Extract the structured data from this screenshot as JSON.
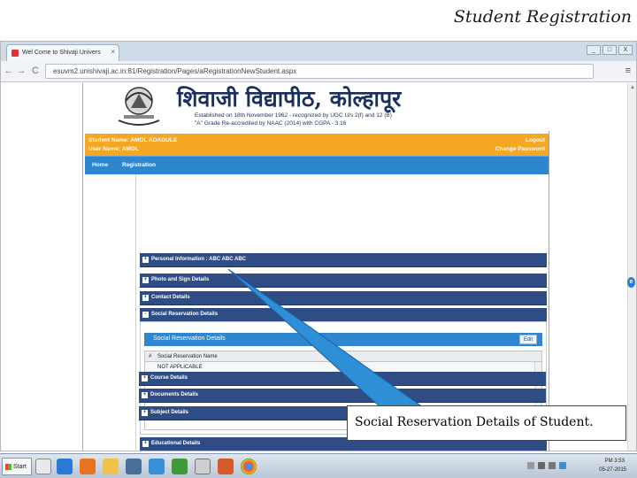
{
  "slide": {
    "title": "Student Registration",
    "callout_text": "Social Reservation Details of Student."
  },
  "browser": {
    "tab_title": "Wel Come to Shivaji Univers",
    "tab_close": "×",
    "url": "esuvm2.unishivaji.ac.in:81/Registration/Pages/aRegistrationNewStudent.aspx",
    "window_buttons": [
      "_",
      "□",
      "X"
    ],
    "back_label": "←",
    "forward_label": "→",
    "reload_label": "C",
    "menu_label": "≡"
  },
  "header": {
    "university_name": "शिवाजी विद्यापीठ, कोल्हापूर",
    "line1": "Established on 18th November 1962 - recognized by UGC U/s 2(f) and 12 (B)",
    "line2": "\"A\" Grade Re-accredited by NAAC (2014) with CGPA - 3.16"
  },
  "user_bar": {
    "student_name": "Student Name: AMOL ADAGULE",
    "user_name": "User Name: AMOL",
    "logout": "Logout",
    "change_password": "Change Password"
  },
  "nav": {
    "items": [
      "Home",
      "Registration"
    ]
  },
  "sections": [
    {
      "label": "Personal Information : ABC ABC ABC",
      "toggle": "+"
    },
    {
      "label": "Photo and Sign Details",
      "toggle": "+"
    },
    {
      "label": "Contact Details",
      "toggle": "+"
    },
    {
      "label": "Social Reservation Details",
      "toggle": "-"
    },
    {
      "label": "Educational Details",
      "toggle": "+"
    },
    {
      "label": "Course Details",
      "toggle": "+"
    },
    {
      "label": "Documents Details",
      "toggle": "+"
    },
    {
      "label": "Subject Details",
      "toggle": "+"
    }
  ],
  "reservation_panel": {
    "title": "Social Reservation Details",
    "edit_label": "Edit",
    "columns": [
      "#",
      "Social Reservation Name"
    ],
    "rows": [
      [
        "",
        "NOT APPLICABLE"
      ]
    ]
  },
  "taskbar": {
    "start_label": "Start",
    "time": "PM 3:53",
    "date": "05-27-2015"
  },
  "colors": {
    "user_bar": "#f5a623",
    "nav_bar": "#2e86cf",
    "section_header": "#2f4d84",
    "callout_fill": "#2e8fd6"
  }
}
